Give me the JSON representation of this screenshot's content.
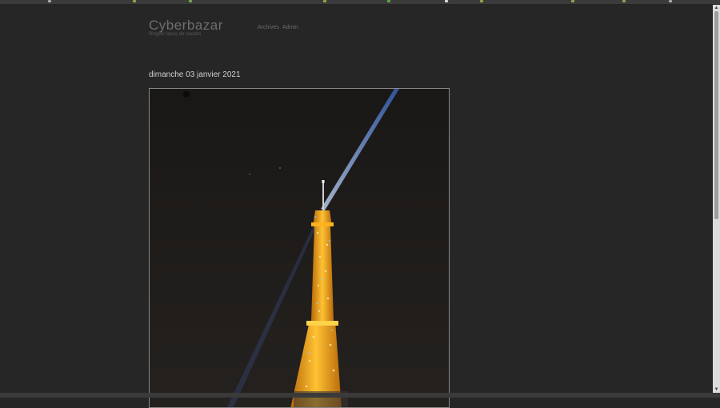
{
  "blog": {
    "title": "Cyberbazar",
    "subtitle": "Ringue l'anus de cacahs",
    "nav": [
      "Archives",
      "Admin"
    ]
  },
  "post": {
    "date": "dimanche 03 janvier 2021",
    "photo_subject": "eiffel-tower-at-night"
  },
  "colors": {
    "background": "#262626",
    "tower_light": "#ffb21e",
    "beacon": "#6aa6ff"
  }
}
